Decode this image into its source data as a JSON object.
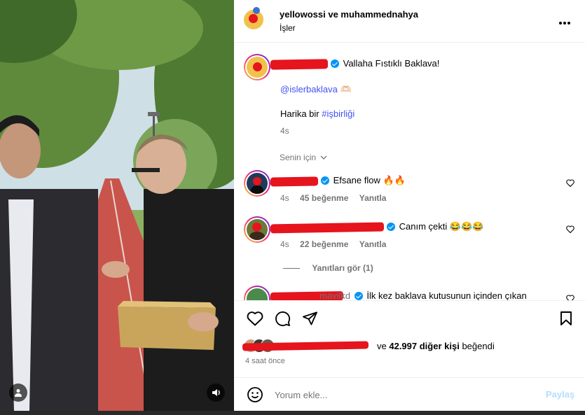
{
  "header": {
    "usernames": "yellowossi ve muhammednahya",
    "subtitle": "İşler"
  },
  "caption": {
    "text": "Vallaha Fıstıklı Baklava!",
    "mention": "@islerbaklava",
    "mention_suffix": "🫶🏻",
    "line3_prefix": "Harika bir",
    "hashtag": "#işbirliği",
    "time": "4s"
  },
  "filter_label": "Senin için",
  "comments": [
    {
      "text": "Efsane flow",
      "emoji": "🔥🔥",
      "time": "4s",
      "likes": "45 beğenme",
      "reply": "Yanıtla"
    },
    {
      "text": "Canım çekti",
      "emoji": "😂😂😂",
      "time": "4s",
      "likes": "22 beğenme",
      "reply": "Yanıtla",
      "view_replies": "Yanıtları gör (1)"
    },
    {
      "visible_suffix": "mavilkd",
      "text": "İlk kez baklava kutusunun içinden çıkan"
    }
  ],
  "likes": {
    "suffix": "ve",
    "count_label": "42.997 diğer kişi",
    "end": "beğendi"
  },
  "timestamp": "4 saat önce",
  "comment_box": {
    "placeholder": "Yorum ekle...",
    "post_label": "Paylaş"
  },
  "colors": {
    "accent_blue": "#0095f6",
    "link_blue": "#4150f7",
    "redaction": "#e6141d",
    "post_disabled": "#b2dffc"
  },
  "icons": [
    "more-icon",
    "heart-icon",
    "comment-icon",
    "share-icon",
    "bookmark-icon",
    "emoji-icon",
    "user-tag-icon",
    "sound-icon",
    "chevron-down-icon",
    "verified-badge-icon"
  ]
}
